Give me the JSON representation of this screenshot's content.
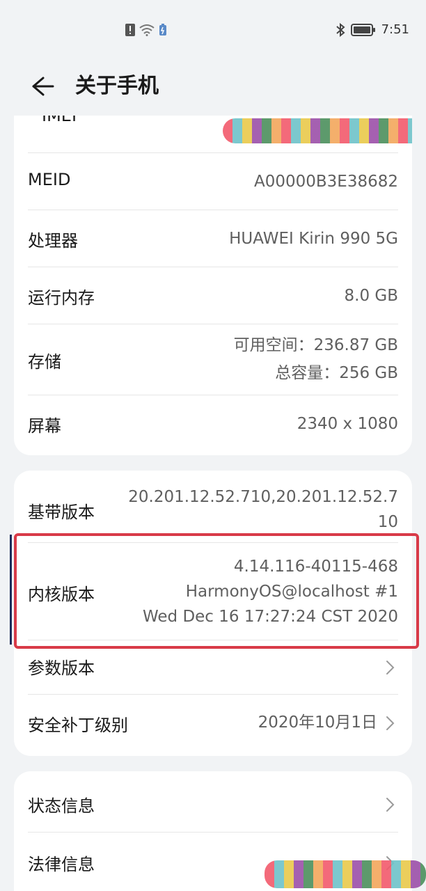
{
  "status_bar": {
    "time": "7:51",
    "icons": [
      "notification-icon",
      "wifi-icon",
      "battery-saver-icon",
      "bluetooth-icon",
      "battery-icon"
    ]
  },
  "header": {
    "title": "关于手机",
    "back_icon": "back-arrow-icon"
  },
  "card1": {
    "imei_label": "IMEI",
    "rows": [
      {
        "label": "MEID",
        "value": "A00000B3E38682"
      },
      {
        "label": "处理器",
        "value": "HUAWEI Kirin 990 5G"
      },
      {
        "label": "运行内存",
        "value": "8.0 GB"
      },
      {
        "label": "存储",
        "value_line1": "可用空间：236.87  GB",
        "value_line2": "总容量：256  GB"
      },
      {
        "label": "屏幕",
        "value": "2340 x 1080"
      }
    ]
  },
  "card2": {
    "rows": [
      {
        "label": "基带版本",
        "value_line1": "20.201.12.52.710,20.201.12.52.7",
        "value_line2": "10"
      },
      {
        "label": "内核版本",
        "value_line1": "4.14.116-40115-468",
        "value_line2": "HarmonyOS@localhost #1",
        "value_line3": "Wed Dec 16 17:27:24 CST 2020"
      },
      {
        "label": "参数版本",
        "value": ""
      },
      {
        "label": "安全补丁级别",
        "value": "2020年10月1日"
      }
    ]
  },
  "card3": {
    "rows": [
      {
        "label": "状态信息"
      },
      {
        "label": "法律信息"
      }
    ]
  },
  "colors": {
    "background": "#f1f3f5",
    "card": "#ffffff",
    "highlight": "#d83a48",
    "text_primary": "#1a1a1a",
    "text_secondary": "#5f5f5f"
  }
}
